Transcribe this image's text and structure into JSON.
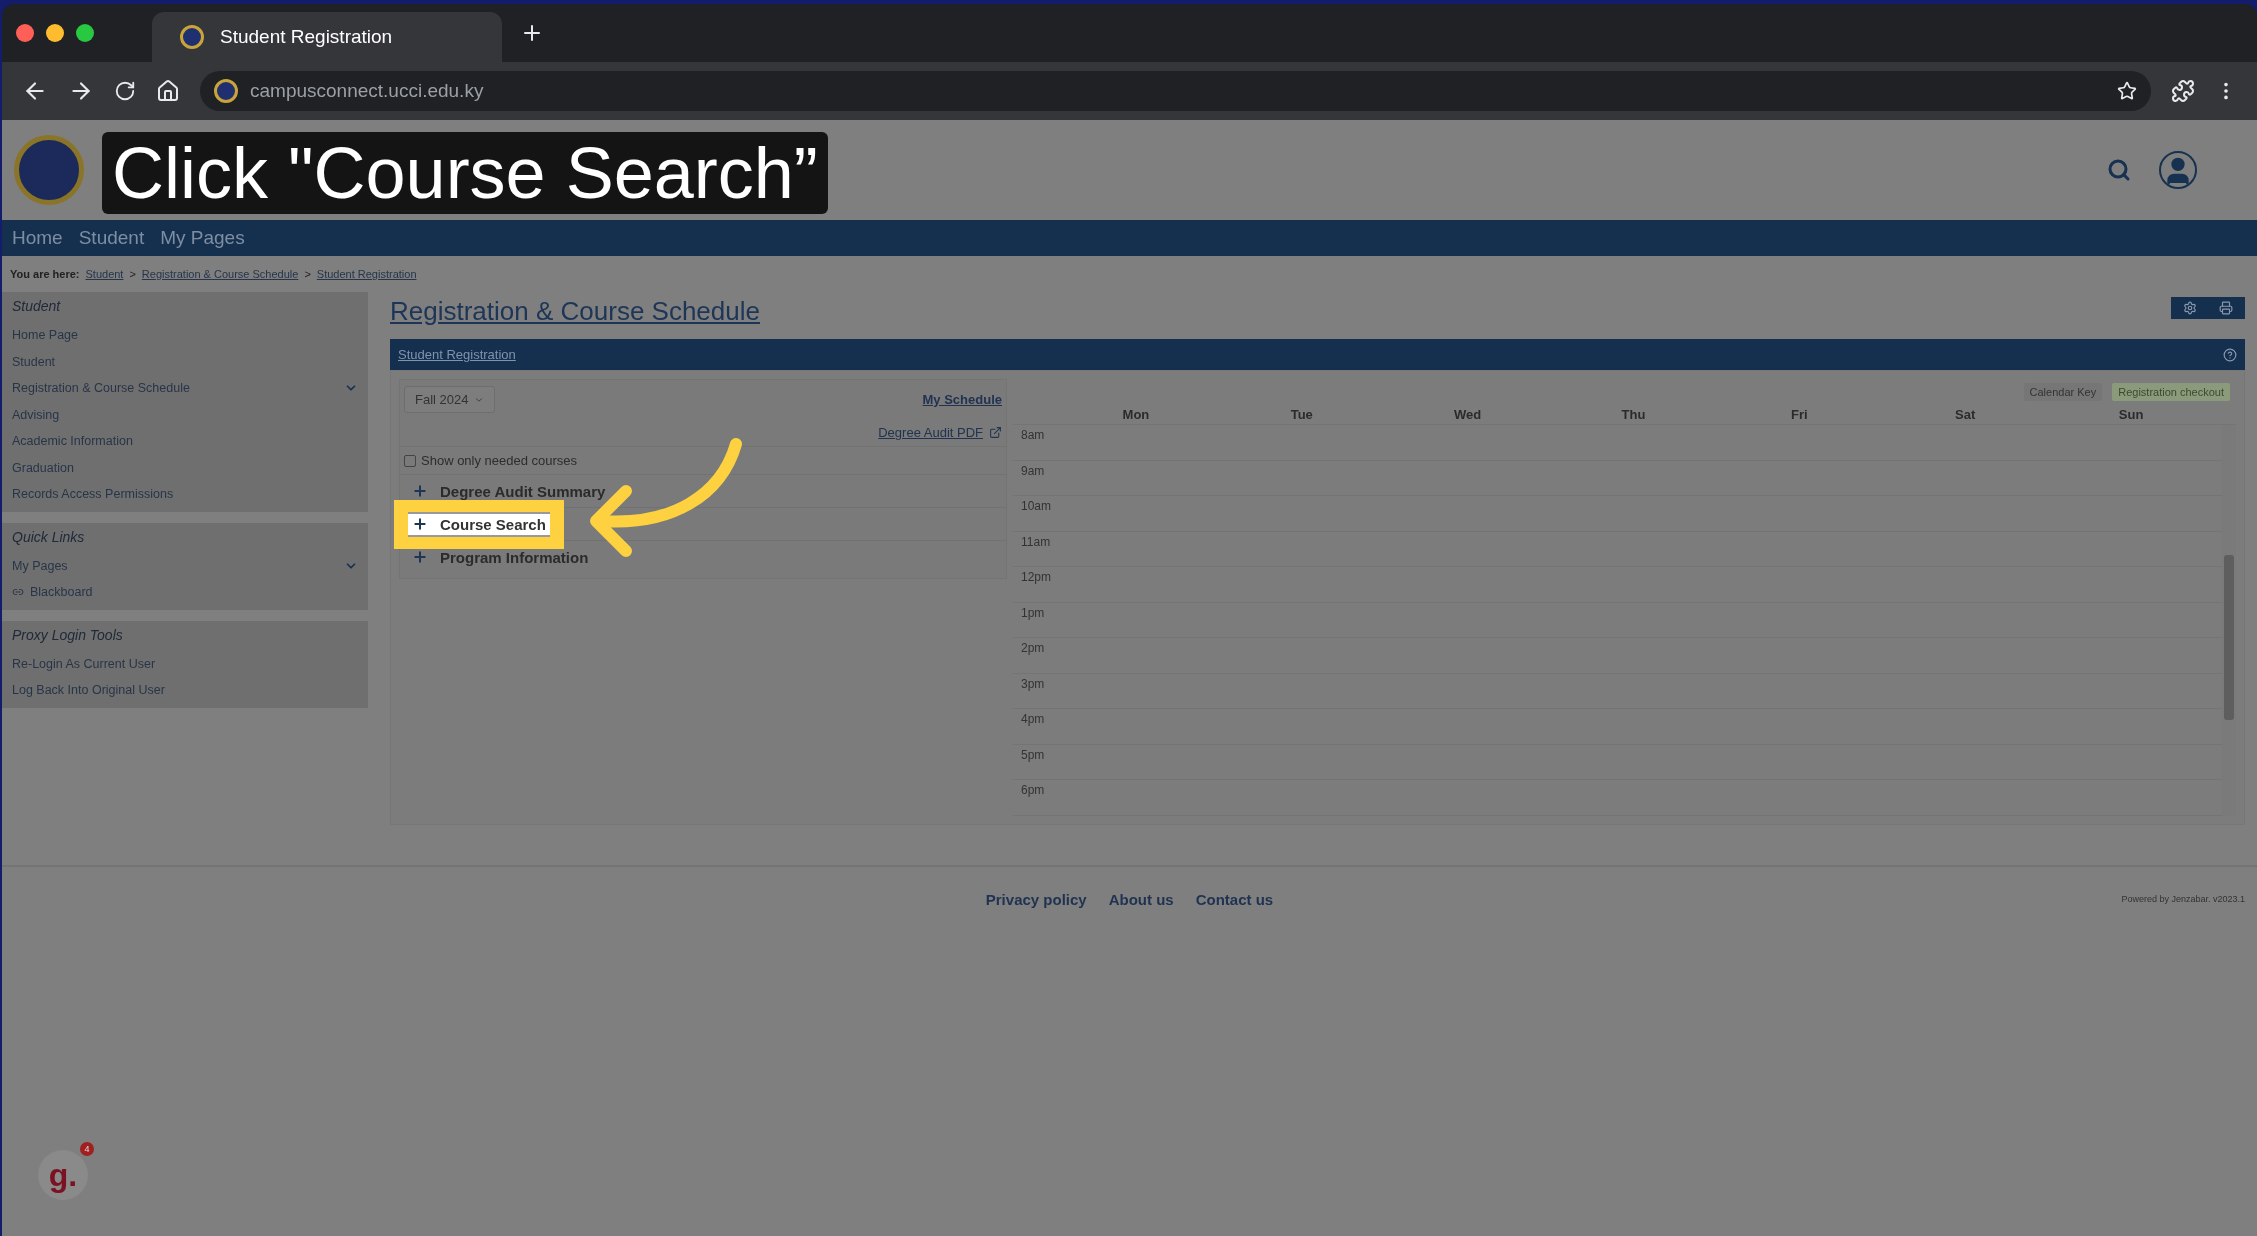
{
  "browser": {
    "tab_title": "Student Registration",
    "url": "campusconnect.ucci.edu.ky"
  },
  "caption": "Click \"Course Search”",
  "nav": [
    "Home",
    "Student",
    "My Pages"
  ],
  "breadcrumb": {
    "label": "You are here:",
    "separator": ">",
    "crumbs": [
      "Student",
      "Registration & Course Schedule",
      "Student Registration"
    ]
  },
  "sidebar": [
    {
      "title": "Student",
      "items": [
        {
          "label": "Home Page",
          "expandable": false,
          "kind": "page"
        },
        {
          "label": "Student",
          "expandable": false,
          "kind": "page"
        },
        {
          "label": "Registration & Course Schedule",
          "expandable": true,
          "kind": "page"
        },
        {
          "label": "Advising",
          "expandable": false,
          "kind": "page"
        },
        {
          "label": "Academic Information",
          "expandable": false,
          "kind": "page"
        },
        {
          "label": "Graduation",
          "expandable": false,
          "kind": "page"
        },
        {
          "label": "Records Access Permissions",
          "expandable": false,
          "kind": "page"
        }
      ]
    },
    {
      "title": "Quick Links",
      "items": [
        {
          "label": "My Pages",
          "expandable": true,
          "kind": "page"
        },
        {
          "label": "Blackboard",
          "expandable": false,
          "kind": "external"
        }
      ]
    },
    {
      "title": "Proxy Login Tools",
      "items": [
        {
          "label": "Re-Login As Current User",
          "expandable": false,
          "kind": "page"
        },
        {
          "label": "Log Back Into Original User",
          "expandable": false,
          "kind": "page"
        }
      ]
    }
  ],
  "page_title": "Registration & Course Schedule",
  "panel": {
    "title": "Student Registration",
    "term": "Fall 2024",
    "my_schedule": "My Schedule",
    "degree_audit": "Degree Audit PDF",
    "needed_only": {
      "label": "Show only needed courses",
      "checked": false
    },
    "sections": [
      {
        "label": "Degree Audit Summary",
        "highlighted": false
      },
      {
        "label": "Course Search",
        "highlighted": true
      },
      {
        "label": "Program Information",
        "highlighted": false
      }
    ]
  },
  "calendar": {
    "calendar_key": "Calendar Key",
    "checkout": "Registration checkout",
    "days": [
      "Mon",
      "Tue",
      "Wed",
      "Thu",
      "Fri",
      "Sat",
      "Sun"
    ],
    "times": [
      "8am",
      "9am",
      "10am",
      "11am",
      "12pm",
      "1pm",
      "2pm",
      "3pm",
      "4pm",
      "5pm",
      "6pm"
    ]
  },
  "footer": {
    "links": [
      "Privacy policy",
      "About us",
      "Contact us"
    ],
    "powered": "Powered by Jenzabar. v2023.1"
  },
  "helper_badge": {
    "letter": "g.",
    "count": "4"
  }
}
